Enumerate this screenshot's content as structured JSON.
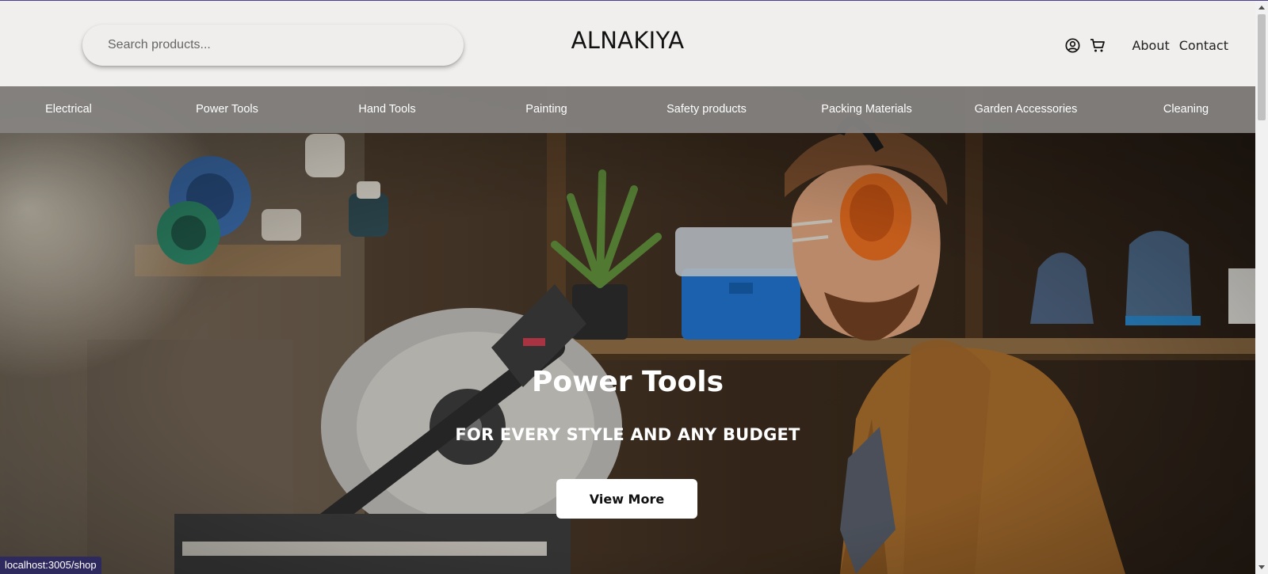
{
  "header": {
    "search_placeholder": "Search products...",
    "logo": "ALNAKIYA",
    "links": [
      "About",
      "Contact"
    ],
    "icons": [
      "user-circle-icon",
      "cart-icon"
    ]
  },
  "categories": [
    "Electrical",
    "Power Tools",
    "Hand Tools",
    "Painting",
    "Safety products",
    "Packing Materials",
    "Garden Accessories",
    "Cleaning"
  ],
  "hero": {
    "title": "Power Tools",
    "subtitle": "FOR EVERY STYLE AND ANY BUDGET",
    "button_label": "View More"
  },
  "status_url": "localhost:3005/shop",
  "colors": {
    "header_bg": "#f0efed",
    "nav_overlay": "#878482",
    "button_bg": "#ffffff",
    "status_bg": "#2f2a5e"
  }
}
